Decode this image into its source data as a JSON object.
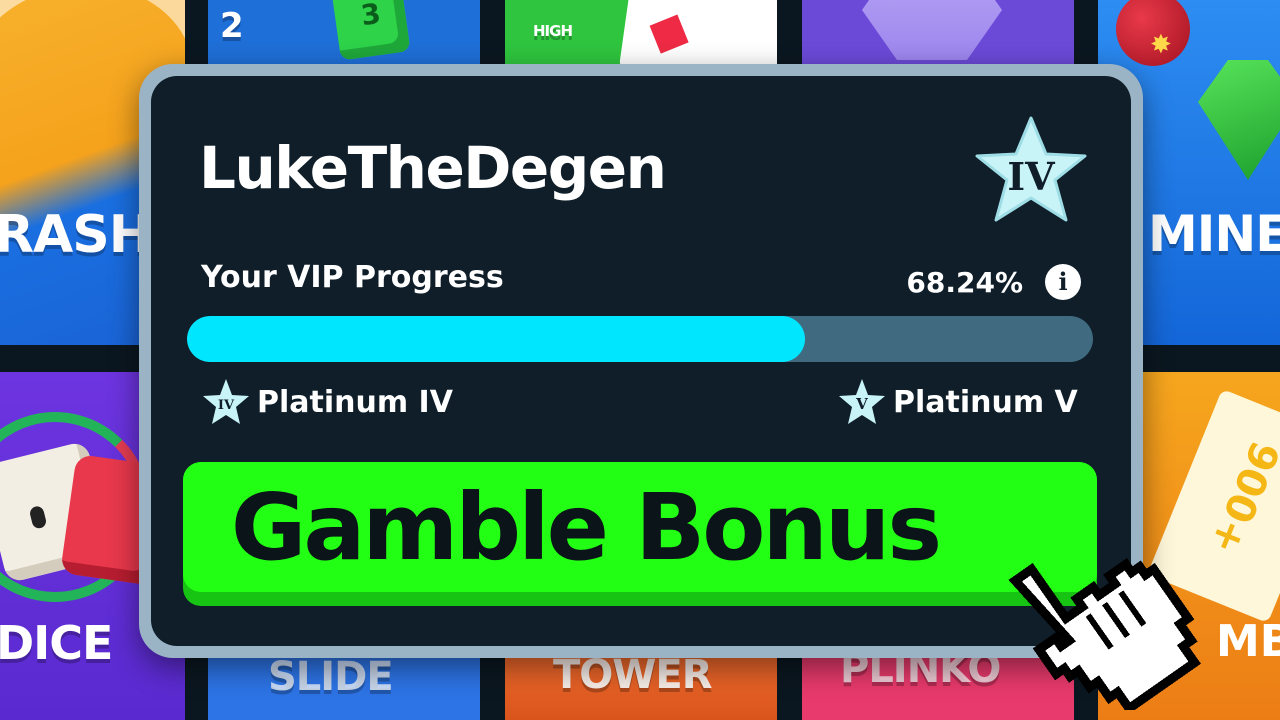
{
  "background_tiles": {
    "crash": {
      "label": "RASH"
    },
    "top_plinko": {
      "label": "2",
      "cube_number": "3"
    },
    "hilo": {
      "label": "HIGH"
    },
    "mines": {
      "label": "MINE"
    },
    "dice": {
      "label": "DICE"
    },
    "slide": {
      "label": "SLIDE"
    },
    "tower": {
      "label": "TOWER"
    },
    "plinko": {
      "label": "PLINKO"
    },
    "limbo": {
      "label": "MBO",
      "ticket": "900+"
    }
  },
  "vip_card": {
    "username": "LukeTheDegen",
    "tier_badge": "IV",
    "progress_label": "Your VIP Progress",
    "progress_percent_text": "68.24%",
    "progress_fraction": 0.6824,
    "info_icon": "i",
    "current_level": {
      "badge": "IV",
      "name": "Platinum IV"
    },
    "next_level": {
      "badge": "V",
      "name": "Platinum V"
    },
    "action_button": "Gamble Bonus"
  },
  "colors": {
    "card_bg": "#0f1e28",
    "card_border": "#9ab4c6",
    "progress_fill": "#00e6ff",
    "progress_track": "#3f6a80",
    "button_green": "#22ff14",
    "badge_star": "#c8f4f8"
  },
  "icons": {
    "tier_badge": "star-icon",
    "info": "info-icon",
    "cursor": "hand-pointer-icon"
  }
}
